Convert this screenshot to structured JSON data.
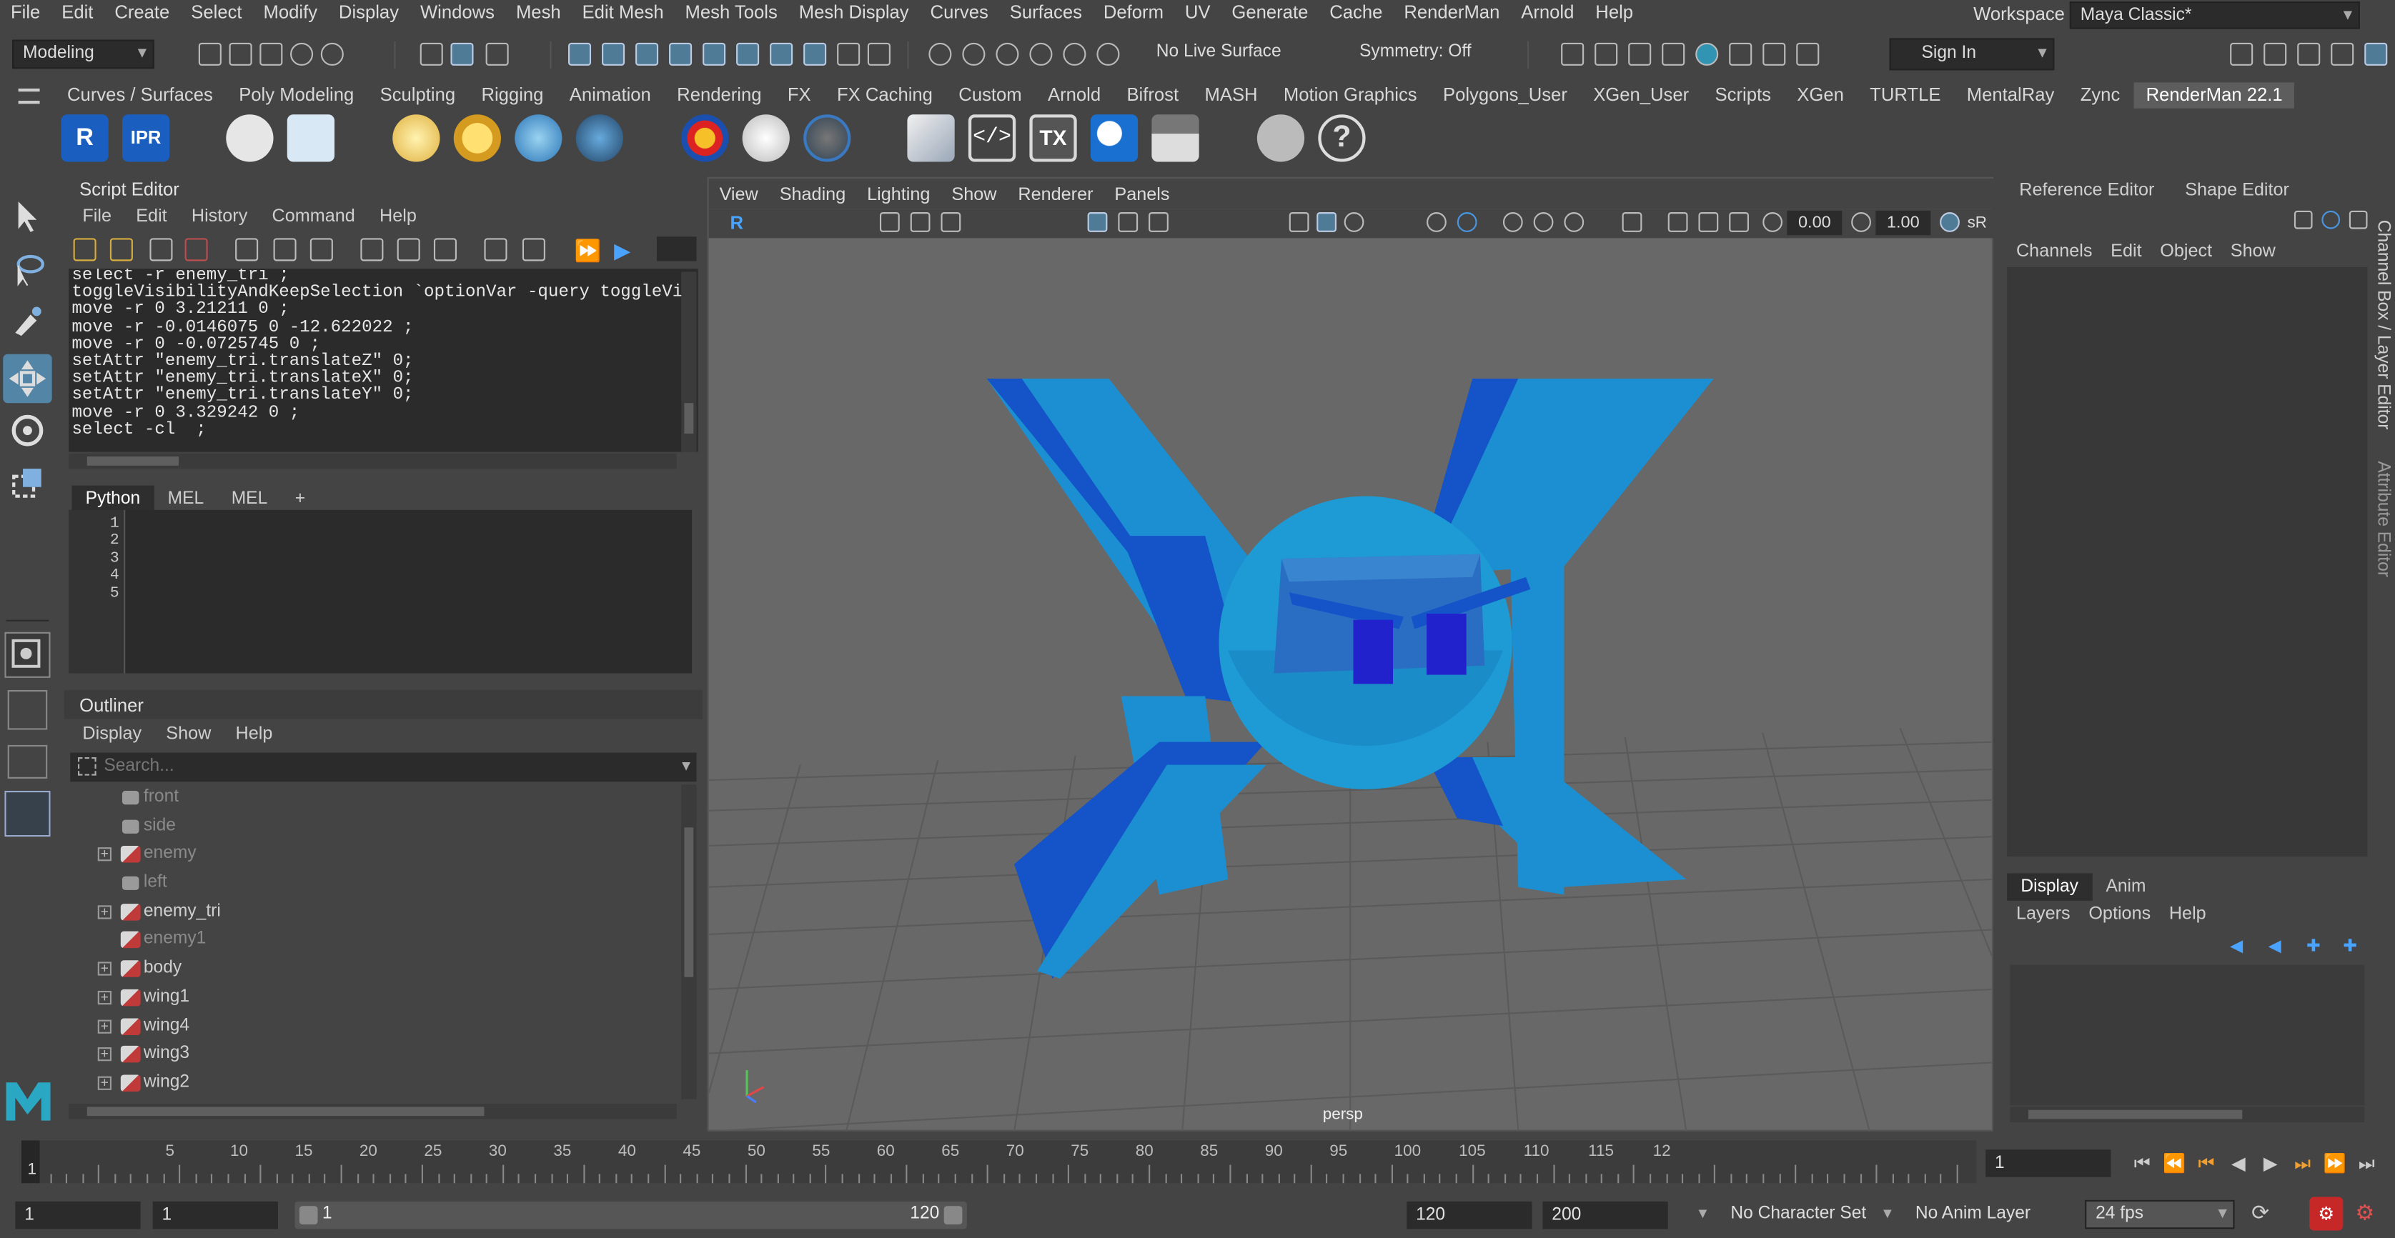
{
  "menus": [
    "File",
    "Edit",
    "Create",
    "Select",
    "Modify",
    "Display",
    "Windows",
    "Mesh",
    "Edit Mesh",
    "Mesh Tools",
    "Mesh Display",
    "Curves",
    "Surfaces",
    "Deform",
    "UV",
    "Generate",
    "Cache",
    "RenderMan",
    "Arnold",
    "Help"
  ],
  "workspace": {
    "label": "Workspace :",
    "value": "Maya Classic*"
  },
  "status": {
    "mode": "Modeling",
    "live_surface": "No Live Surface",
    "symmetry": "Symmetry: Off",
    "sign_in": "Sign In"
  },
  "shelf_tabs": [
    "Curves / Surfaces",
    "Poly Modeling",
    "Sculpting",
    "Rigging",
    "Animation",
    "Rendering",
    "FX",
    "FX Caching",
    "Custom",
    "Arnold",
    "Bifrost",
    "MASH",
    "Motion Graphics",
    "Polygons_User",
    "XGen_User",
    "Scripts",
    "XGen",
    "TURTLE",
    "MentalRay",
    "Zync",
    "RenderMan 22.1"
  ],
  "shelf_icon_labels": {
    "r": "R",
    "ipr": "IPR",
    "tx": "TX"
  },
  "script_editor": {
    "title": "Script Editor",
    "menu": [
      "File",
      "Edit",
      "History",
      "Command",
      "Help"
    ],
    "history": [
      "select -r enemy_tri ;",
      "toggleVisibilityAndKeepSelection `optionVar -query toggleVi",
      "move -r 0 3.21211 0 ;",
      "move -r -0.0146075 0 -12.622022 ;",
      "move -r 0 -0.0725745 0 ;",
      "setAttr \"enemy_tri.translateZ\" 0;",
      "setAttr \"enemy_tri.translateX\" 0;",
      "setAttr \"enemy_tri.translateY\" 0;",
      "move -r 0 3.329242 0 ;",
      "select -cl  ;"
    ],
    "tabs": [
      "Python",
      "MEL",
      "MEL",
      "+"
    ],
    "line_numbers": [
      "1",
      "2",
      "3",
      "4",
      "5"
    ]
  },
  "outliner": {
    "title": "Outliner",
    "menu": [
      "Display",
      "Show",
      "Help"
    ],
    "search_placeholder": "Search...",
    "items": [
      {
        "name": "front",
        "type": "camera",
        "dim": true,
        "expandable": false
      },
      {
        "name": "side",
        "type": "camera",
        "dim": true,
        "expandable": false
      },
      {
        "name": "enemy",
        "type": "mesh",
        "dim": true,
        "expandable": true
      },
      {
        "name": "left",
        "type": "camera",
        "dim": true,
        "expandable": false
      },
      {
        "name": "enemy_tri",
        "type": "mesh",
        "dim": false,
        "expandable": true
      },
      {
        "name": "enemy1",
        "type": "mesh",
        "dim": true,
        "expandable": false
      },
      {
        "name": "body",
        "type": "mesh",
        "dim": false,
        "expandable": true
      },
      {
        "name": "wing1",
        "type": "mesh",
        "dim": false,
        "expandable": true
      },
      {
        "name": "wing4",
        "type": "mesh",
        "dim": false,
        "expandable": true
      },
      {
        "name": "wing3",
        "type": "mesh",
        "dim": false,
        "expandable": true
      },
      {
        "name": "wing2",
        "type": "mesh",
        "dim": false,
        "expandable": true
      }
    ]
  },
  "viewport": {
    "menu": [
      "View",
      "Shading",
      "Lighting",
      "Show",
      "Renderer",
      "Panels"
    ],
    "camera": "persp",
    "field1": "0.00",
    "field2": "1.00",
    "colorspace": "sR"
  },
  "right_panel": {
    "tabs": [
      "Reference Editor",
      "Shape Editor"
    ],
    "channel_menu": [
      "Channels",
      "Edit",
      "Object",
      "Show"
    ],
    "layer_tabs": [
      "Display",
      "Anim"
    ],
    "layer_menu": [
      "Layers",
      "Options",
      "Help"
    ],
    "side_tabs": [
      "Channel Box / Layer Editor",
      "Attribute Editor"
    ]
  },
  "timeline": {
    "ticks": [
      "5",
      "10",
      "15",
      "20",
      "25",
      "30",
      "35",
      "40",
      "45",
      "50",
      "55",
      "60",
      "65",
      "70",
      "75",
      "80",
      "85",
      "90",
      "95",
      "100",
      "105",
      "110",
      "115",
      "12"
    ],
    "marker": "1",
    "current_frame": "1"
  },
  "range": {
    "start": "1",
    "anim_start": "1",
    "slider_start": "1",
    "slider_end": "120",
    "end": "120",
    "anim_end": "200",
    "character_set": "No Character Set",
    "anim_layer": "No Anim Layer",
    "fps": "24 fps"
  },
  "colors": {
    "accent": "#5285a6",
    "mesh_light": "#1b8fd1",
    "mesh_dark": "#1453c8",
    "eye": "#2222cc"
  }
}
